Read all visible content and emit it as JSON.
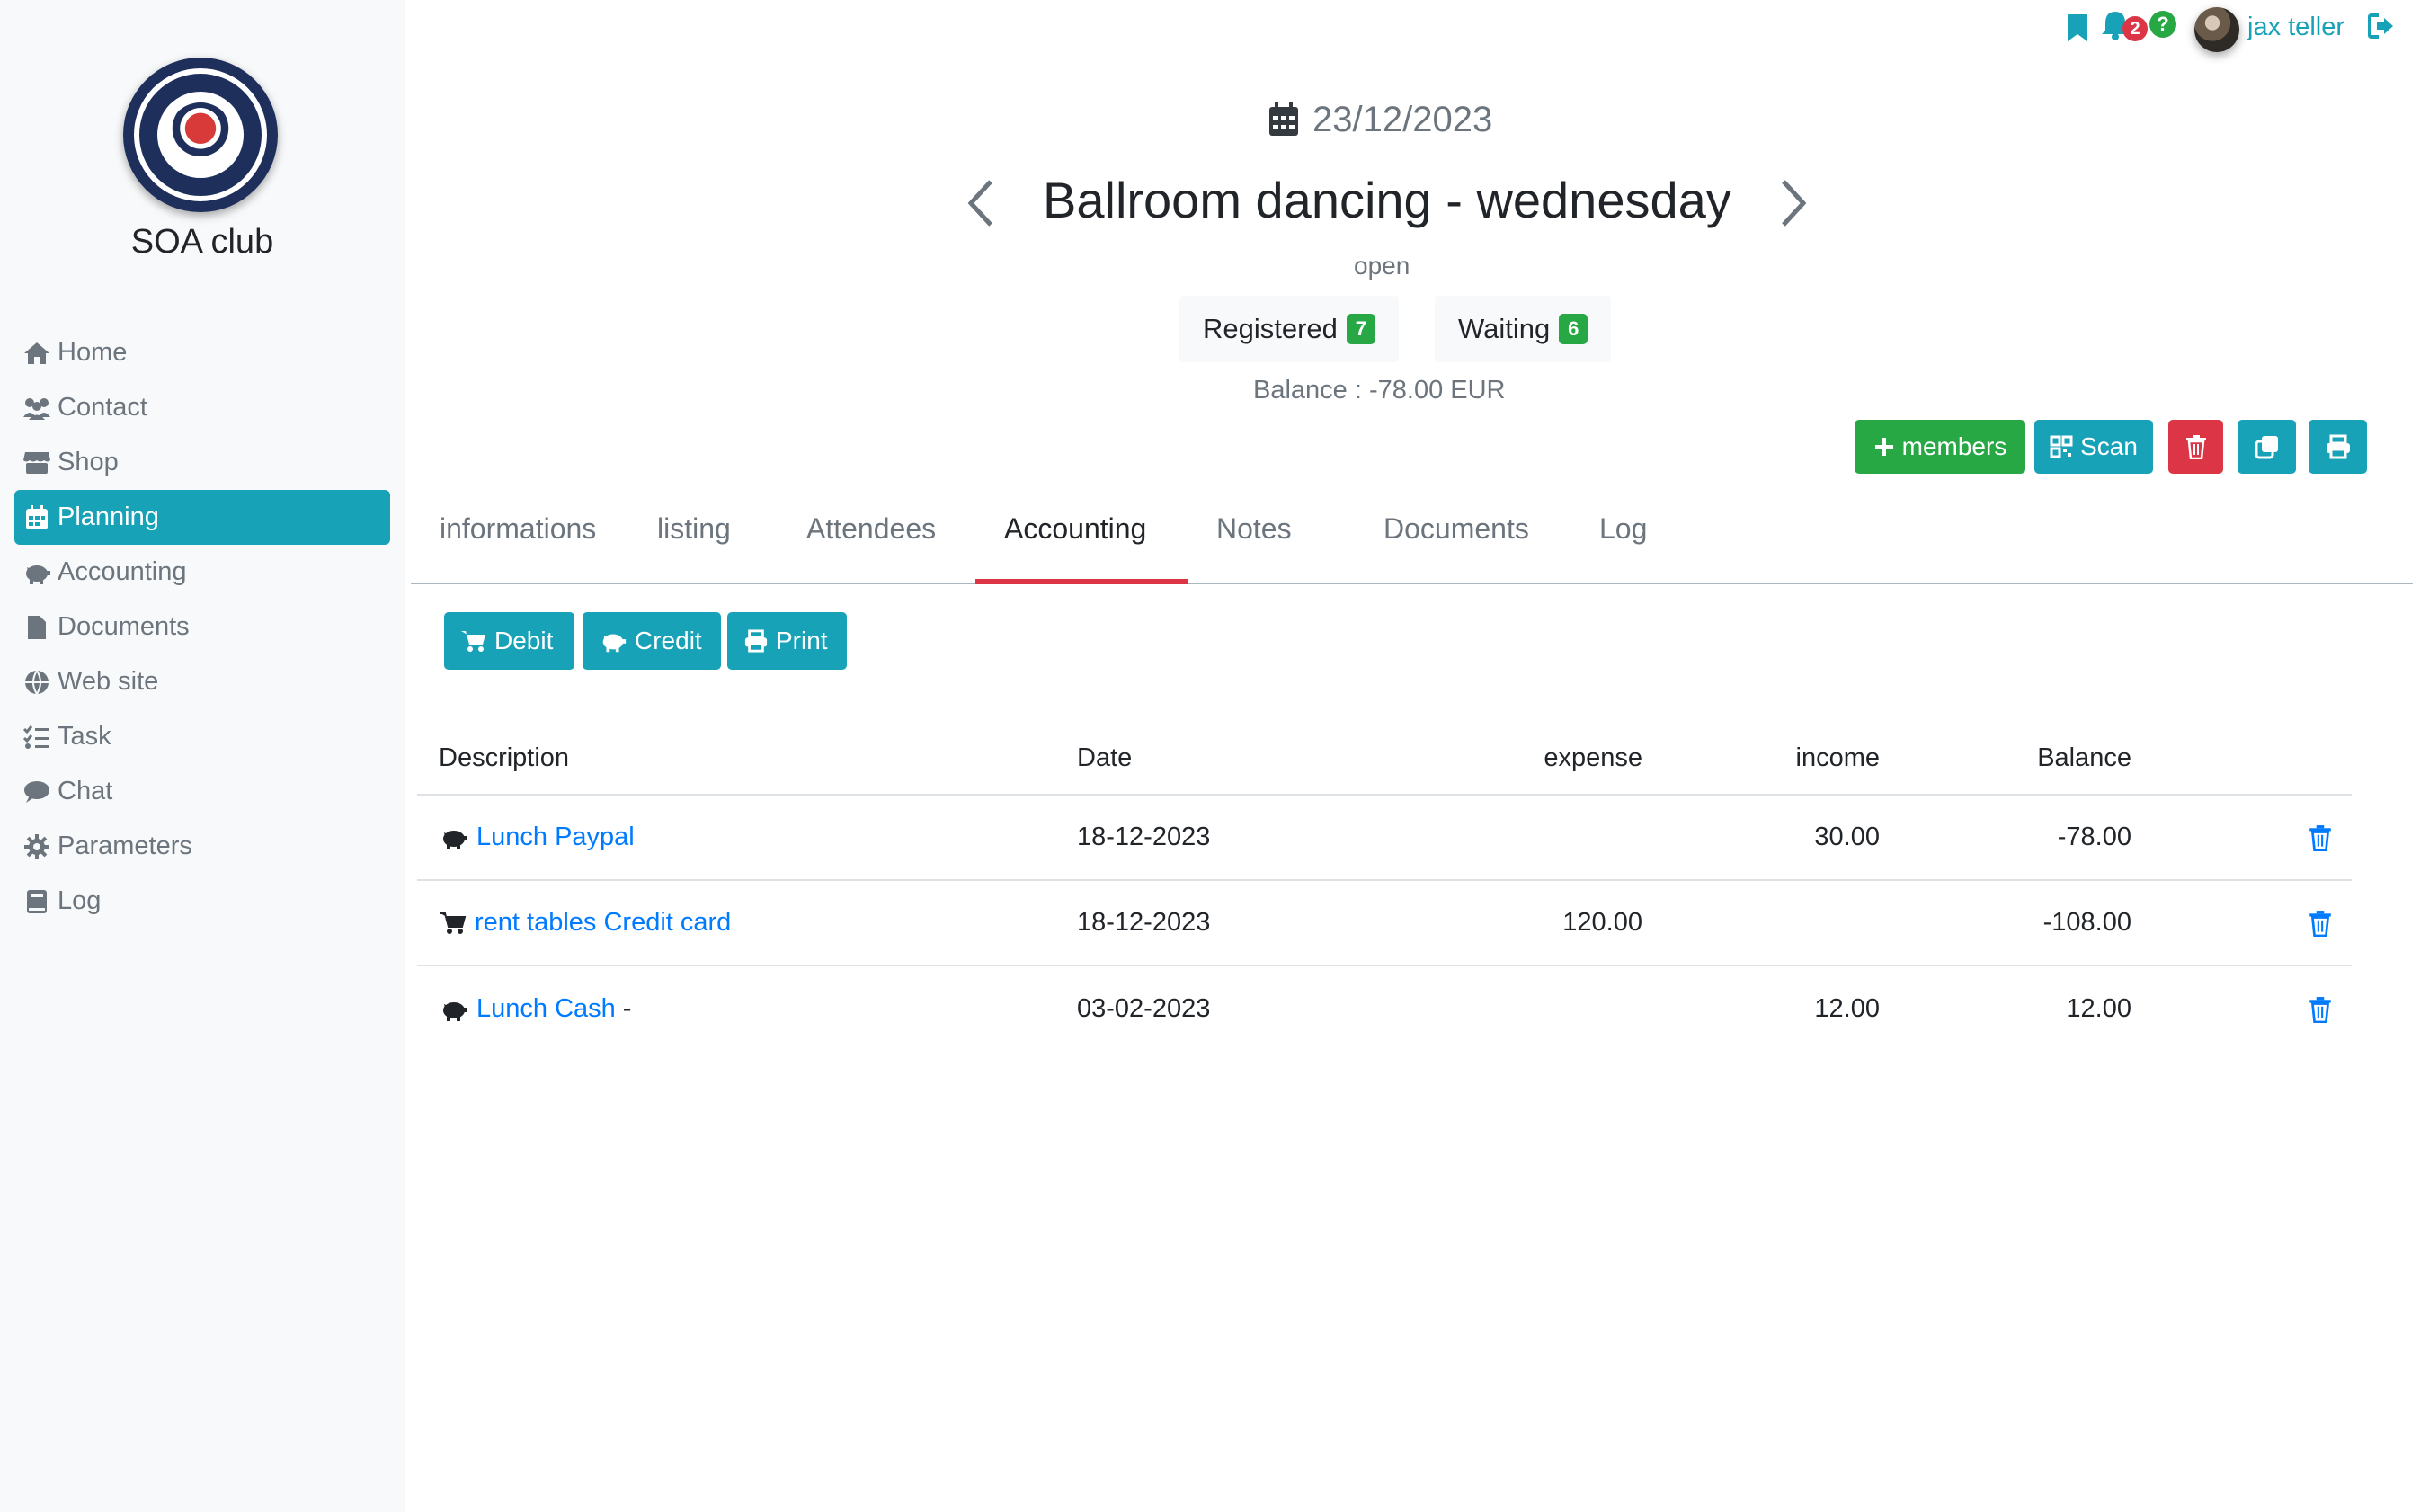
{
  "sidebar": {
    "club_name": "SOA club",
    "items": [
      {
        "label": "Home",
        "icon": "home-icon"
      },
      {
        "label": "Contact",
        "icon": "users-icon"
      },
      {
        "label": "Shop",
        "icon": "store-icon"
      },
      {
        "label": "Planning",
        "icon": "calendar-icon",
        "active": true
      },
      {
        "label": "Accounting",
        "icon": "piggy-bank-icon"
      },
      {
        "label": "Documents",
        "icon": "file-icon"
      },
      {
        "label": "Web site",
        "icon": "globe-icon"
      },
      {
        "label": "Task",
        "icon": "tasks-icon"
      },
      {
        "label": "Chat",
        "icon": "comment-icon"
      },
      {
        "label": "Parameters",
        "icon": "gear-icon"
      },
      {
        "label": "Log",
        "icon": "book-icon"
      }
    ]
  },
  "user": {
    "name": "jax teller",
    "notifications_count": "2",
    "help_label": "?"
  },
  "event": {
    "date": "23/12/2023",
    "title": "Ballroom dancing - wednesday",
    "status": "open",
    "registered_label": "Registered",
    "registered_count": "7",
    "waiting_label": "Waiting",
    "waiting_count": "6",
    "balance": "Balance : -78.00 EUR"
  },
  "actions": {
    "members_label": "members",
    "scan_label": "Scan"
  },
  "tabs": [
    "informations",
    "listing",
    "Attendees",
    "Accounting",
    "Notes",
    "Documents",
    "Log"
  ],
  "active_tab": "Accounting",
  "accounting_buttons": {
    "debit": "Debit",
    "credit": "Credit",
    "print": "Print"
  },
  "table": {
    "headers": {
      "description": "Description",
      "date": "Date",
      "expense": "expense",
      "income": "income",
      "balance": "Balance"
    },
    "rows": [
      {
        "type": "credit",
        "icon": "piggy-bank-icon",
        "description": "Lunch Paypal",
        "suffix": "",
        "date": "18-12-2023",
        "expense": "",
        "income": "30.00",
        "balance": "-78.00"
      },
      {
        "type": "debit",
        "icon": "cart-icon",
        "description": "rent tables Credit card",
        "suffix": "",
        "date": "18-12-2023",
        "expense": "120.00",
        "income": "",
        "balance": "-108.00"
      },
      {
        "type": "credit",
        "icon": "piggy-bank-icon",
        "description": "Lunch Cash",
        "suffix": "-",
        "date": "03-02-2023",
        "expense": "",
        "income": "12.00",
        "balance": "12.00"
      }
    ]
  },
  "colors": {
    "accent": "#17a2b8",
    "success": "#28a745",
    "danger": "#dc3545",
    "link": "#007bff"
  }
}
